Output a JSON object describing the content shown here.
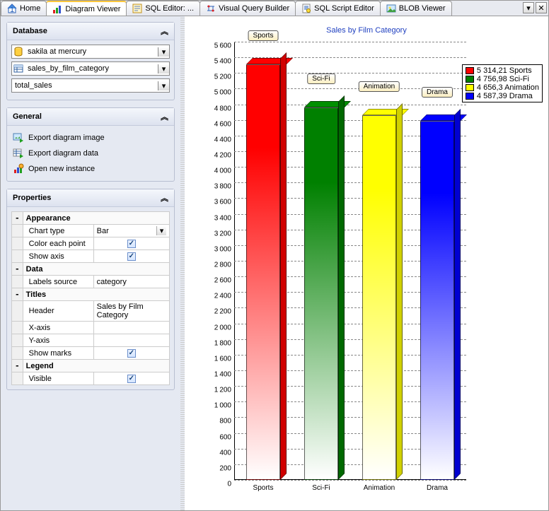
{
  "tabs": [
    {
      "label": "Home",
      "icon": "home"
    },
    {
      "label": "Diagram Viewer",
      "icon": "chart",
      "active": true
    },
    {
      "label": "SQL Editor: ...",
      "icon": "sql"
    },
    {
      "label": "Visual Query Builder",
      "icon": "vqb"
    },
    {
      "label": "SQL Script Editor",
      "icon": "script"
    },
    {
      "label": "BLOB Viewer",
      "icon": "blob"
    }
  ],
  "panels": {
    "database": {
      "title": "Database",
      "combos": [
        {
          "icon": "db",
          "value": "sakila at mercury"
        },
        {
          "icon": "table",
          "value": "sales_by_film_category"
        },
        {
          "icon": "",
          "value": "total_sales"
        }
      ]
    },
    "general": {
      "title": "General",
      "actions": [
        {
          "icon": "export-img",
          "label": "Export diagram image"
        },
        {
          "icon": "export-data",
          "label": "Export diagram data"
        },
        {
          "icon": "new-inst",
          "label": "Open new instance"
        }
      ]
    },
    "properties": {
      "title": "Properties",
      "groups": [
        {
          "name": "Appearance",
          "rows": [
            {
              "label": "Chart type",
              "value": "Bar",
              "combo": true
            },
            {
              "label": "Color each point",
              "checked": true
            },
            {
              "label": "Show axis",
              "checked": true
            }
          ]
        },
        {
          "name": "Data",
          "rows": [
            {
              "label": "Labels source",
              "value": "category"
            }
          ]
        },
        {
          "name": "Titles",
          "rows": [
            {
              "label": "Header",
              "value": "Sales by Film Category"
            },
            {
              "label": "X-axis",
              "value": ""
            },
            {
              "label": "Y-axis",
              "value": ""
            },
            {
              "label": "Show marks",
              "checked": true
            }
          ]
        },
        {
          "name": "Legend",
          "rows": [
            {
              "label": "Visible",
              "checked": true
            }
          ]
        }
      ]
    }
  },
  "chart_data": {
    "type": "bar",
    "title": "Sales by Film Category",
    "xlabel": "",
    "ylabel": "",
    "ylim": [
      0,
      5600
    ],
    "ytick_step": 200,
    "categories": [
      "Sports",
      "Sci-Fi",
      "Animation",
      "Drama"
    ],
    "values": [
      5314.21,
      4756.98,
      4656.3,
      4587.39
    ],
    "colors": [
      "#ff0000",
      "#008000",
      "#ffff00",
      "#0000ff"
    ],
    "legend_labels": [
      "5 314,21 Sports",
      "4 756,98 Sci-Fi",
      " 4 656,3 Animation",
      "4 587,39 Drama"
    ]
  }
}
